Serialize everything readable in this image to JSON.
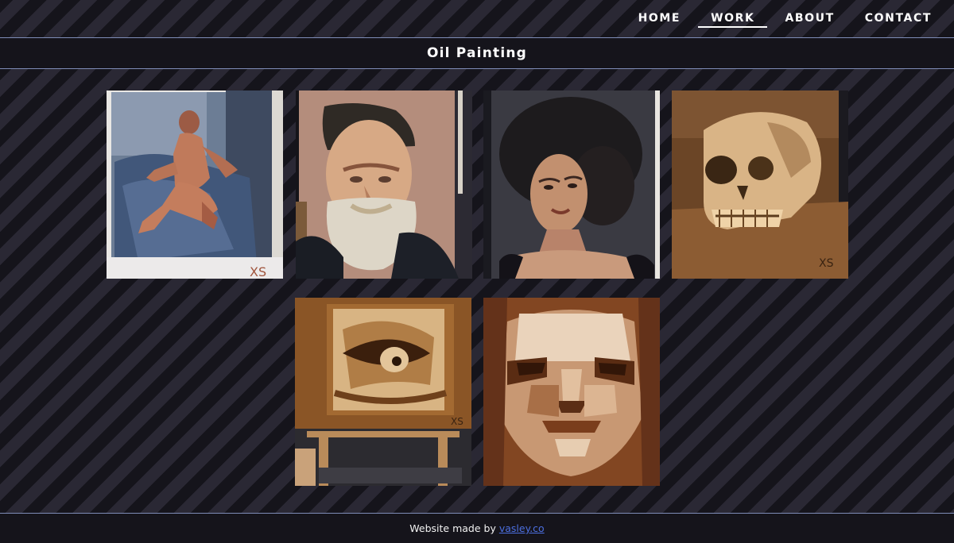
{
  "nav": {
    "items": [
      {
        "label": "HOME",
        "active": false
      },
      {
        "label": "WORK",
        "active": true
      },
      {
        "label": "ABOUT",
        "active": false
      },
      {
        "label": "CONTACT",
        "active": false
      }
    ]
  },
  "page": {
    "title": "Oil Painting"
  },
  "gallery": {
    "paintings": [
      {
        "subject": "reclining-figure"
      },
      {
        "subject": "bearded-man-portrait"
      },
      {
        "subject": "woman-portrait"
      },
      {
        "subject": "skull-study"
      },
      {
        "subject": "eye-cast-study"
      },
      {
        "subject": "planar-head-study"
      }
    ]
  },
  "footer": {
    "text": "Website made by",
    "link_label": "vasley.co"
  },
  "colors": {
    "background": "#15141b",
    "stripe": "#2a2834",
    "divider": "#7f8db8",
    "link": "#4c6fe0"
  }
}
